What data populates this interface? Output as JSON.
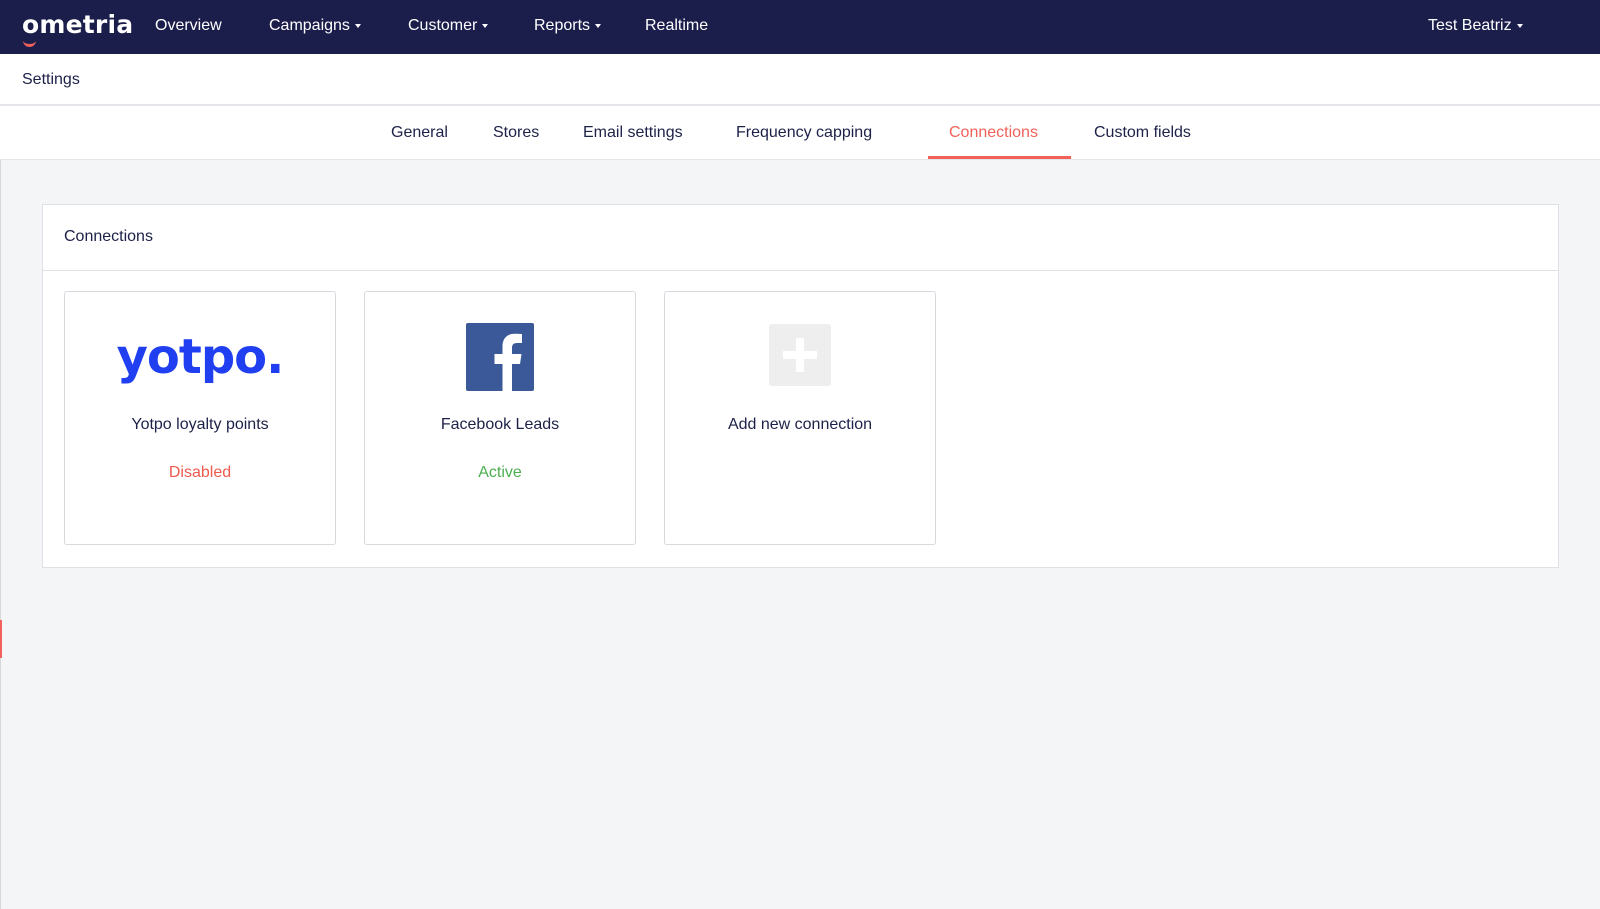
{
  "brand": {
    "logo_text": "ometria",
    "accent_color": "#f2605a",
    "nav_bg": "#1b1e4b"
  },
  "topnav": {
    "items": [
      {
        "label": "Overview",
        "dropdown": false
      },
      {
        "label": "Campaigns",
        "dropdown": true
      },
      {
        "label": "Customer",
        "dropdown": true
      },
      {
        "label": "Reports",
        "dropdown": true
      },
      {
        "label": "Realtime",
        "dropdown": false
      }
    ],
    "user": {
      "label": "Test Beatriz",
      "dropdown": true
    }
  },
  "settings": {
    "title": "Settings"
  },
  "tabs": {
    "items": [
      {
        "label": "General"
      },
      {
        "label": "Stores"
      },
      {
        "label": "Email settings"
      },
      {
        "label": "Frequency capping"
      },
      {
        "label": "Connections"
      },
      {
        "label": "Custom fields"
      }
    ],
    "active": "Connections"
  },
  "panel": {
    "title": "Connections",
    "cards": [
      {
        "name": "Yotpo loyalty points",
        "status": "Disabled",
        "logo": "yotpo-logo",
        "logo_text": "yotpo.",
        "logo_color": "#1f3ff0",
        "status_color": "#ee5a4f"
      },
      {
        "name": "Facebook Leads",
        "status": "Active",
        "logo": "facebook-icon",
        "logo_color": "#3b5998",
        "status_color": "#4caf50"
      },
      {
        "name": "Add new connection",
        "status": "",
        "logo": "plus-icon"
      }
    ]
  }
}
